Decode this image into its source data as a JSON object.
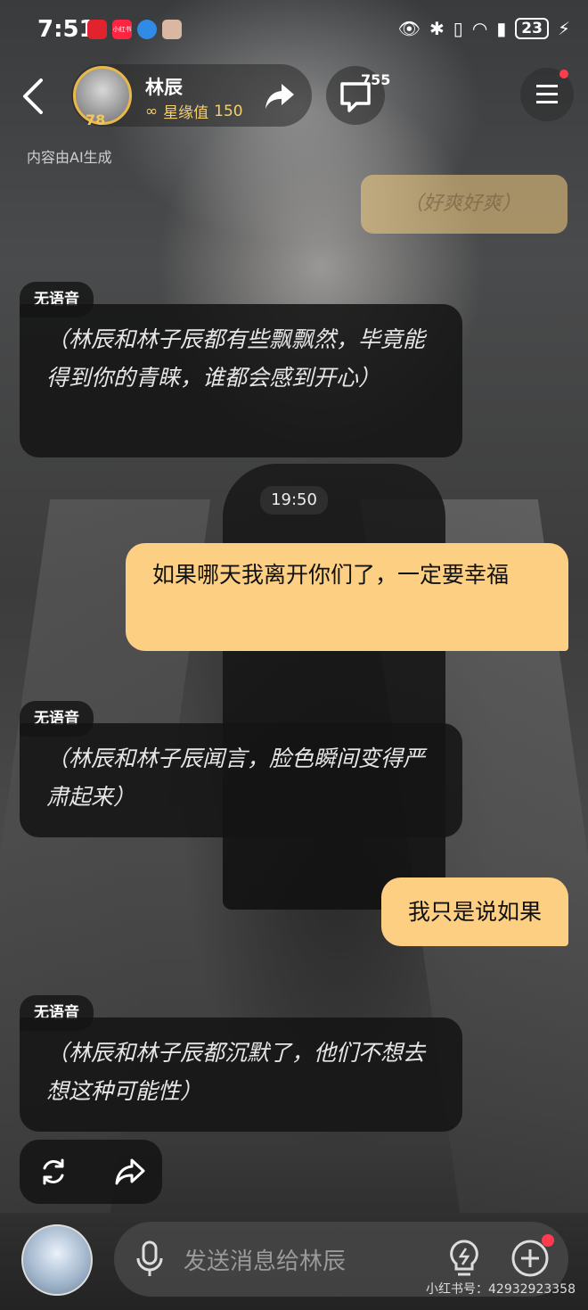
{
  "status_bar": {
    "time": "7:51",
    "battery": "23",
    "app_icons": [
      "huawei-icon",
      "xiaohongshu-icon",
      "browser-icon",
      "avatar-icon"
    ],
    "xhs_label": "小红书"
  },
  "header": {
    "name": "林辰",
    "level": "78",
    "fate_label": "星缘值",
    "fate_value": "150",
    "message_count": "755"
  },
  "ai_note": "内容由AI生成",
  "chat": {
    "faded_user_msg": "（好爽好爽）",
    "messages": [
      {
        "tag": "无语音",
        "text": "（林辰和林子辰都有些飘飘然，毕竟能得到你的青睐，谁都会感到开心）"
      },
      {
        "timestamp": "19:50"
      },
      {
        "user": "如果哪天我离开你们了，一定要幸福"
      },
      {
        "tag": "无语音",
        "text": "（林辰和林子辰闻言，脸色瞬间变得严肃起来）"
      },
      {
        "user": "我只是说如果"
      },
      {
        "tag": "无语音",
        "text": "（林辰和林子辰都沉默了，他们不想去想这种可能性）"
      }
    ]
  },
  "input": {
    "placeholder": "发送消息给林辰"
  },
  "watermark": "小红书号：42932923358",
  "colors": {
    "user_bubble": "#fccf83",
    "ai_bubble": "#141414",
    "accent_gold": "#f6cf6b",
    "notification": "#ff3b4e"
  }
}
